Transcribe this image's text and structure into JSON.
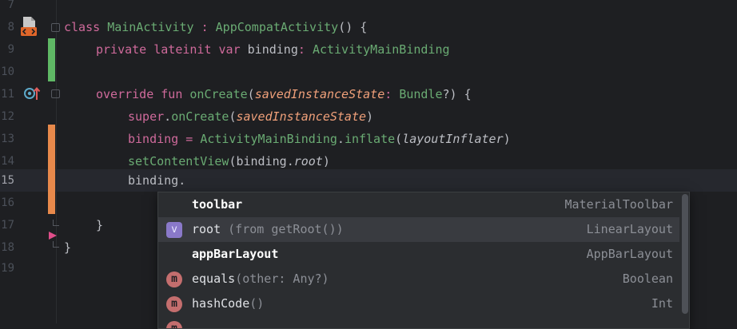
{
  "editor": {
    "line_numbers": [
      "7",
      "8",
      "9",
      "10",
      "11",
      "12",
      "13",
      "14",
      "15",
      "16",
      "17",
      "18",
      "19"
    ],
    "current_line": "15",
    "code": {
      "l8": {
        "kw": "class",
        "name": "MainActivity",
        "colon": " : ",
        "parent": "AppCompatActivity",
        "tail": "() {"
      },
      "l9": {
        "kw": "private lateinit var",
        "name": "binding",
        "colon": ": ",
        "type": "ActivityMainBinding"
      },
      "l11": {
        "kw": "override fun",
        "name": "onCreate",
        "open": "(",
        "param": "savedInstanceState",
        "colon": ": ",
        "type": "Bundle",
        "tail": "?) {"
      },
      "l12": {
        "kw": "super",
        "dot": ".",
        "call": "onCreate",
        "open": "(",
        "param": "savedInstanceState",
        "close": ")"
      },
      "l13": {
        "name": "binding",
        "eq": " = ",
        "type": "ActivityMainBinding",
        "dot": ".",
        "call": "inflate",
        "open": "(",
        "arg": "layoutInflater",
        "close": ")"
      },
      "l14": {
        "call": "setContentView",
        "open": "(",
        "obj": "binding",
        "dot": ".",
        "prop": "root",
        "close": ")"
      },
      "l15": {
        "text": "binding."
      },
      "l17": {
        "text": "}"
      },
      "l18": {
        "text": "}"
      }
    }
  },
  "completion": {
    "items": [
      {
        "icon": "",
        "name": "toolbar",
        "hint": "",
        "type": "MaterialToolbar"
      },
      {
        "icon": "v",
        "name": "root",
        "hint": " (from getRoot())",
        "type": "LinearLayout"
      },
      {
        "icon": "",
        "name": "appBarLayout",
        "hint": "",
        "type": "AppBarLayout"
      },
      {
        "icon": "m",
        "name": "equals",
        "hint": "(other: Any?)",
        "type": "Boolean"
      },
      {
        "icon": "m",
        "name": "hashCode",
        "hint": "()",
        "type": "Int"
      },
      {
        "icon": "m",
        "name": "",
        "hint": "",
        "type": ""
      }
    ]
  },
  "colors": {
    "background": "#1e1f22",
    "change_added": "#5fb865",
    "change_modified": "#e8894b",
    "selected_row": "#393b40"
  }
}
